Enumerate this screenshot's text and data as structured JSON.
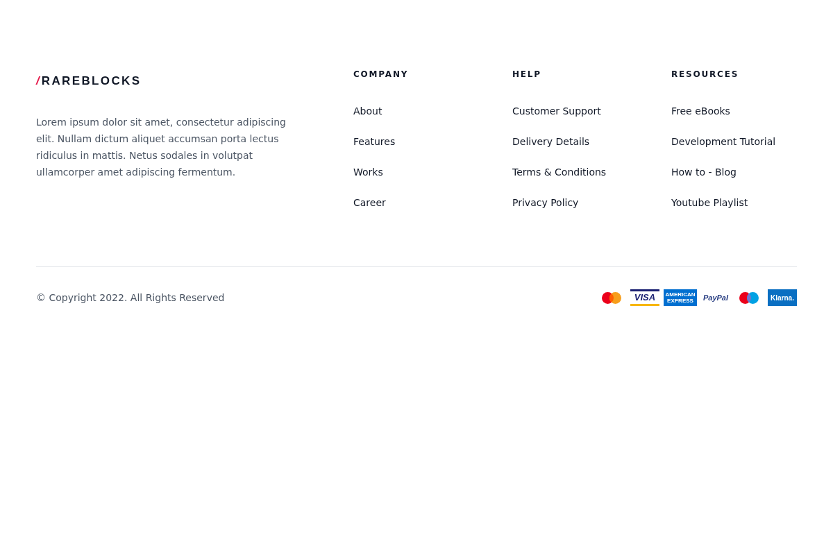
{
  "logo": {
    "mark": "/",
    "name": "RAREBLOCKS"
  },
  "description": "Lorem ipsum dolor sit amet, consectetur adipiscing elit. Nullam dictum aliquet accumsan porta lectus ridiculus in mattis. Netus sodales in volutpat ullamcorper amet adipiscing fermentum.",
  "columns": [
    {
      "heading": "COMPANY",
      "links": [
        "About",
        "Features",
        "Works",
        "Career"
      ]
    },
    {
      "heading": "HELP",
      "links": [
        "Customer Support",
        "Delivery Details",
        "Terms & Conditions",
        "Privacy Policy"
      ]
    },
    {
      "heading": "RESOURCES",
      "links": [
        "Free eBooks",
        "Development Tutorial",
        "How to - Blog",
        "Youtube Playlist"
      ]
    }
  ],
  "copyright": "© Copyright 2022. All Rights Reserved",
  "payment_methods": [
    {
      "kind": "mastercard"
    },
    {
      "kind": "visa",
      "label": "VISA"
    },
    {
      "kind": "amex",
      "label": "AMERICAN EXPRESS"
    },
    {
      "kind": "paypal",
      "label": "PayPal"
    },
    {
      "kind": "maestro"
    },
    {
      "kind": "klarna",
      "label": "Klarna."
    }
  ]
}
